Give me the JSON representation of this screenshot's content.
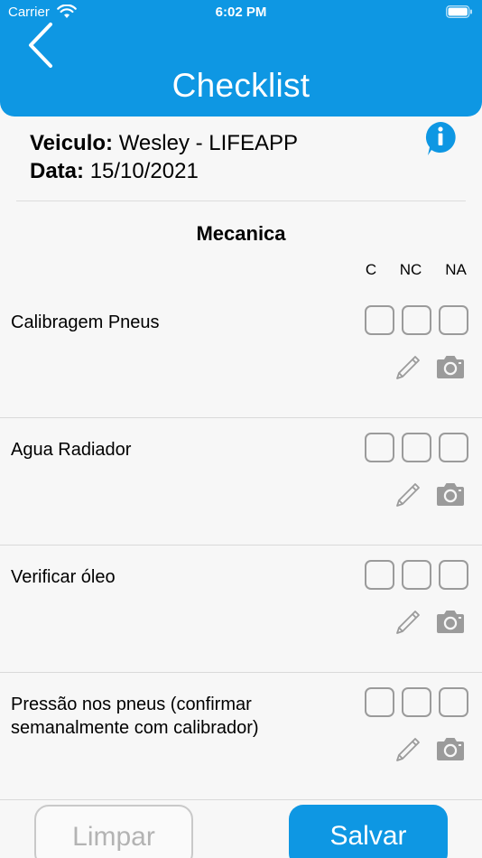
{
  "status_bar": {
    "carrier": "Carrier",
    "time": "6:02 PM"
  },
  "header": {
    "title": "Checklist"
  },
  "info": {
    "vehicle_label": "Veiculo:",
    "vehicle_value": "Wesley - LIFEAPP",
    "date_label": "Data:",
    "date_value": "15/10/2021"
  },
  "section": {
    "title": "Mecanica",
    "columns": [
      "C",
      "NC",
      "NA"
    ],
    "items": [
      {
        "label": "Calibragem Pneus"
      },
      {
        "label": "Agua Radiador"
      },
      {
        "label": "Verificar óleo"
      },
      {
        "label": "Pressão nos pneus (confirmar semanalmente com calibrador)"
      }
    ]
  },
  "buttons": {
    "clear": "Limpar",
    "save": "Salvar"
  },
  "colors": {
    "accent": "#0e97e3",
    "checkbox_border": "#9b9b9b",
    "icon": "#9b9b9b"
  }
}
